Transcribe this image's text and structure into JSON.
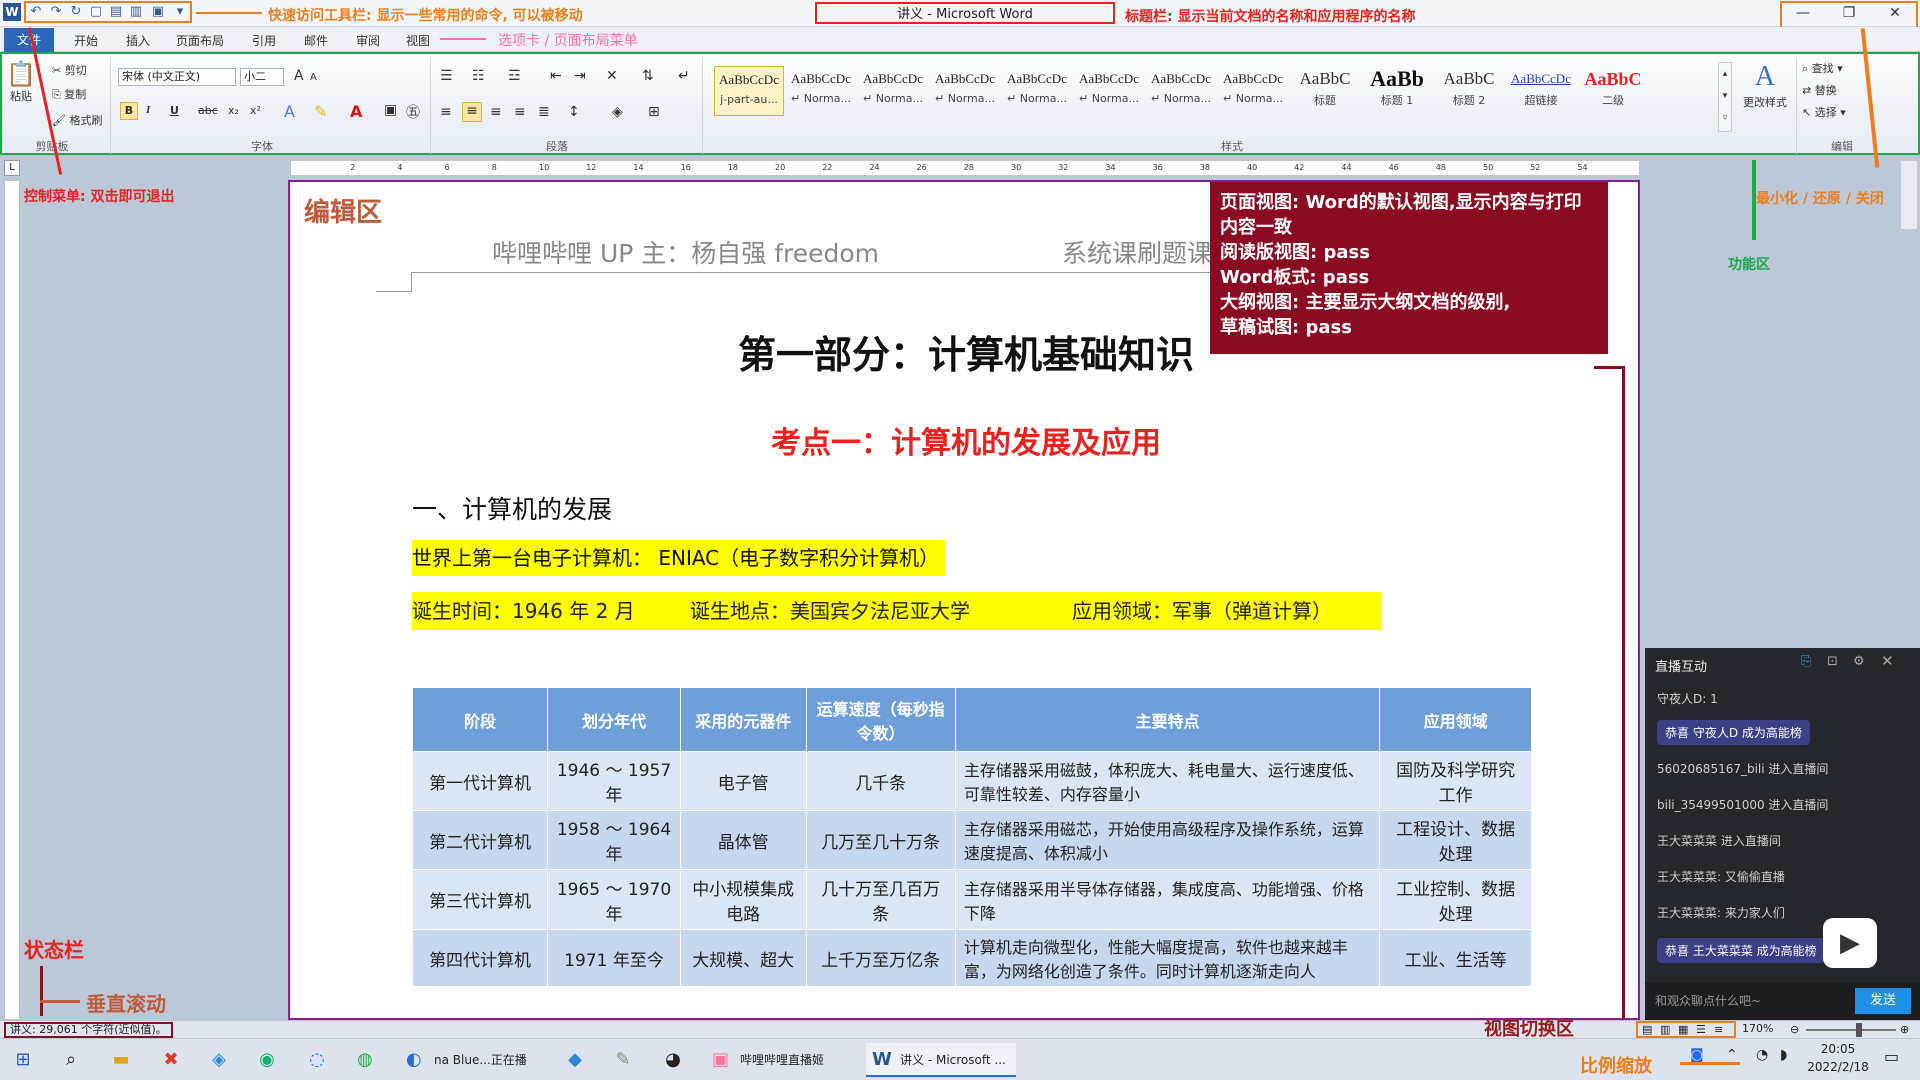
{
  "window": {
    "title": "讲义 - Microsoft Word",
    "minimize": "—",
    "restore": "❐",
    "close": "✕"
  },
  "tabs": [
    "开始",
    "插入",
    "页面布局",
    "引用",
    "邮件",
    "审阅",
    "视图"
  ],
  "file_tab": "文件",
  "ribbon": {
    "clipboard": {
      "paste": "粘贴",
      "cut": "剪切",
      "copy": "复制",
      "format_painter": "格式刷",
      "label": "剪贴板"
    },
    "font": {
      "font_name": "宋体 (中文正文)",
      "font_size": "小二",
      "label": "字体",
      "bold": "B",
      "italic": "I",
      "underline": "U",
      "strike": "abc",
      "sub": "x₂",
      "sup": "x²",
      "grow": "A",
      "shrink": "A"
    },
    "paragraph": {
      "label": "段落"
    },
    "styles": {
      "label": "样式",
      "items": [
        {
          "preview": "AaBbCcDc",
          "name": "j-part-au..."
        },
        {
          "preview": "AaBbCcDc",
          "name": "↵ Norma..."
        },
        {
          "preview": "AaBbCcDc",
          "name": "↵ Norma..."
        },
        {
          "preview": "AaBbCcDc",
          "name": "↵ Norma..."
        },
        {
          "preview": "AaBbCcDc",
          "name": "↵ Norma..."
        },
        {
          "preview": "AaBbCcDc",
          "name": "↵ Norma..."
        },
        {
          "preview": "AaBbCcDc",
          "name": "↵ Norma..."
        },
        {
          "preview": "AaBbCcDc",
          "name": "↵ Norma..."
        },
        {
          "preview": "AaBbC",
          "name": "标题"
        },
        {
          "preview": "AaBb",
          "name": "标题 1"
        },
        {
          "preview": "AaBbC",
          "name": "标题 2"
        },
        {
          "preview": "AaBbCcDc",
          "name": "超链接"
        },
        {
          "preview": "AaBbC",
          "name": "二级"
        }
      ],
      "change_styles": "更改样式"
    },
    "editing": {
      "label": "编辑",
      "find": "查找",
      "replace": "替换",
      "select": "选择"
    }
  },
  "document": {
    "header_left": "哔哩哔哩 UP 主：杨自强 freedom",
    "header_right": "系统课刷题课",
    "part_title": "第一部分：计算机基础知识",
    "point_title": "考点一：计算机的发展及应用",
    "section_title": "一、计算机的发展",
    "line1": "世界上第一台电子计算机：  ENIAC（电子数字积分计算机）",
    "line2_a": "诞生时间：1946 年 2 月",
    "line2_b": "诞生地点：美国宾夕法尼亚大学",
    "line2_c": "应用领域：军事（弹道计算）",
    "table": {
      "headers": [
        "阶段",
        "划分年代",
        "采用的元器件",
        "运算速度（每秒指令数）",
        "主要特点",
        "应用领域"
      ],
      "rows": [
        [
          "第一代计算机",
          "1946 ～ 1957 年",
          "电子管",
          "几千条",
          "主存储器采用磁鼓，体积庞大、耗电量大、运行速度低、可靠性较差、内存容量小",
          "国防及科学研究工作"
        ],
        [
          "第二代计算机",
          "1958 ～ 1964 年",
          "晶体管",
          "几万至几十万条",
          "主存储器采用磁芯，开始使用高级程序及操作系统，运算速度提高、体积减小",
          "工程设计、数据处理"
        ],
        [
          "第三代计算机",
          "1965 ～ 1970 年",
          "中小规模集成电路",
          "几十万至几百万条",
          "主存储器采用半导体存储器，集成度高、功能增强、价格下降",
          "工业控制、数据处理"
        ],
        [
          "第四代计算机",
          "1971 年至今",
          "大规模、超大",
          "上千万至万亿条",
          "计算机走向微型化，性能大幅度提高，软件也越来越丰富，为网络化创造了条件。同时计算机逐渐走向人",
          "工业、生活等"
        ]
      ]
    }
  },
  "info_box": [
    "页面视图: Word的默认视图,显示内容与打印内容一致",
    "阅读版视图: pass",
    "Word板式: pass",
    "大纲视图: 主要显示大纲文档的级别,",
    "草稿试图:  pass"
  ],
  "annotations": {
    "qat": "快速访问工具栏: 显示一些常用的命令, 可以被移动",
    "titlebar": "标题栏: 显示当前文档的名称和应用程序的名称",
    "tabs": "选项卡 / 页面布局菜单",
    "control_menu": "控制菜单: 双击即可退出",
    "edit_area": "编辑区",
    "min_restore_close": "最小化 / 还原 / 关闭",
    "function_area": "功能区",
    "status_bar": "状态栏",
    "vscroll": "垂直滚动",
    "view_switch": "视图切换区",
    "zoom": "比例缩放"
  },
  "status": {
    "word_count": "讲义: 29,061 个字符(近似值)。",
    "zoom": "170%"
  },
  "chat": {
    "title": "直播互动",
    "rows": [
      "守夜人D: 1",
      "恭喜 守夜人D 成为高能榜",
      "56020685167_bili 进入直播间",
      "bili_35499501000 进入直播间",
      "王大菜菜菜 进入直播间",
      "王大菜菜菜: 又偷偷直播",
      "王大菜菜菜: 来力家人们",
      "恭喜 王大菜菜菜 成为高能榜"
    ],
    "input_placeholder": "和观众聊点什么吧~",
    "send": "发送"
  },
  "taskbar": {
    "apps": [
      "na Blue...正在播放...",
      "哔哩哔哩直播姬",
      "讲义 - Microsoft ..."
    ],
    "time": "20:05",
    "date": "2022/2/18"
  }
}
